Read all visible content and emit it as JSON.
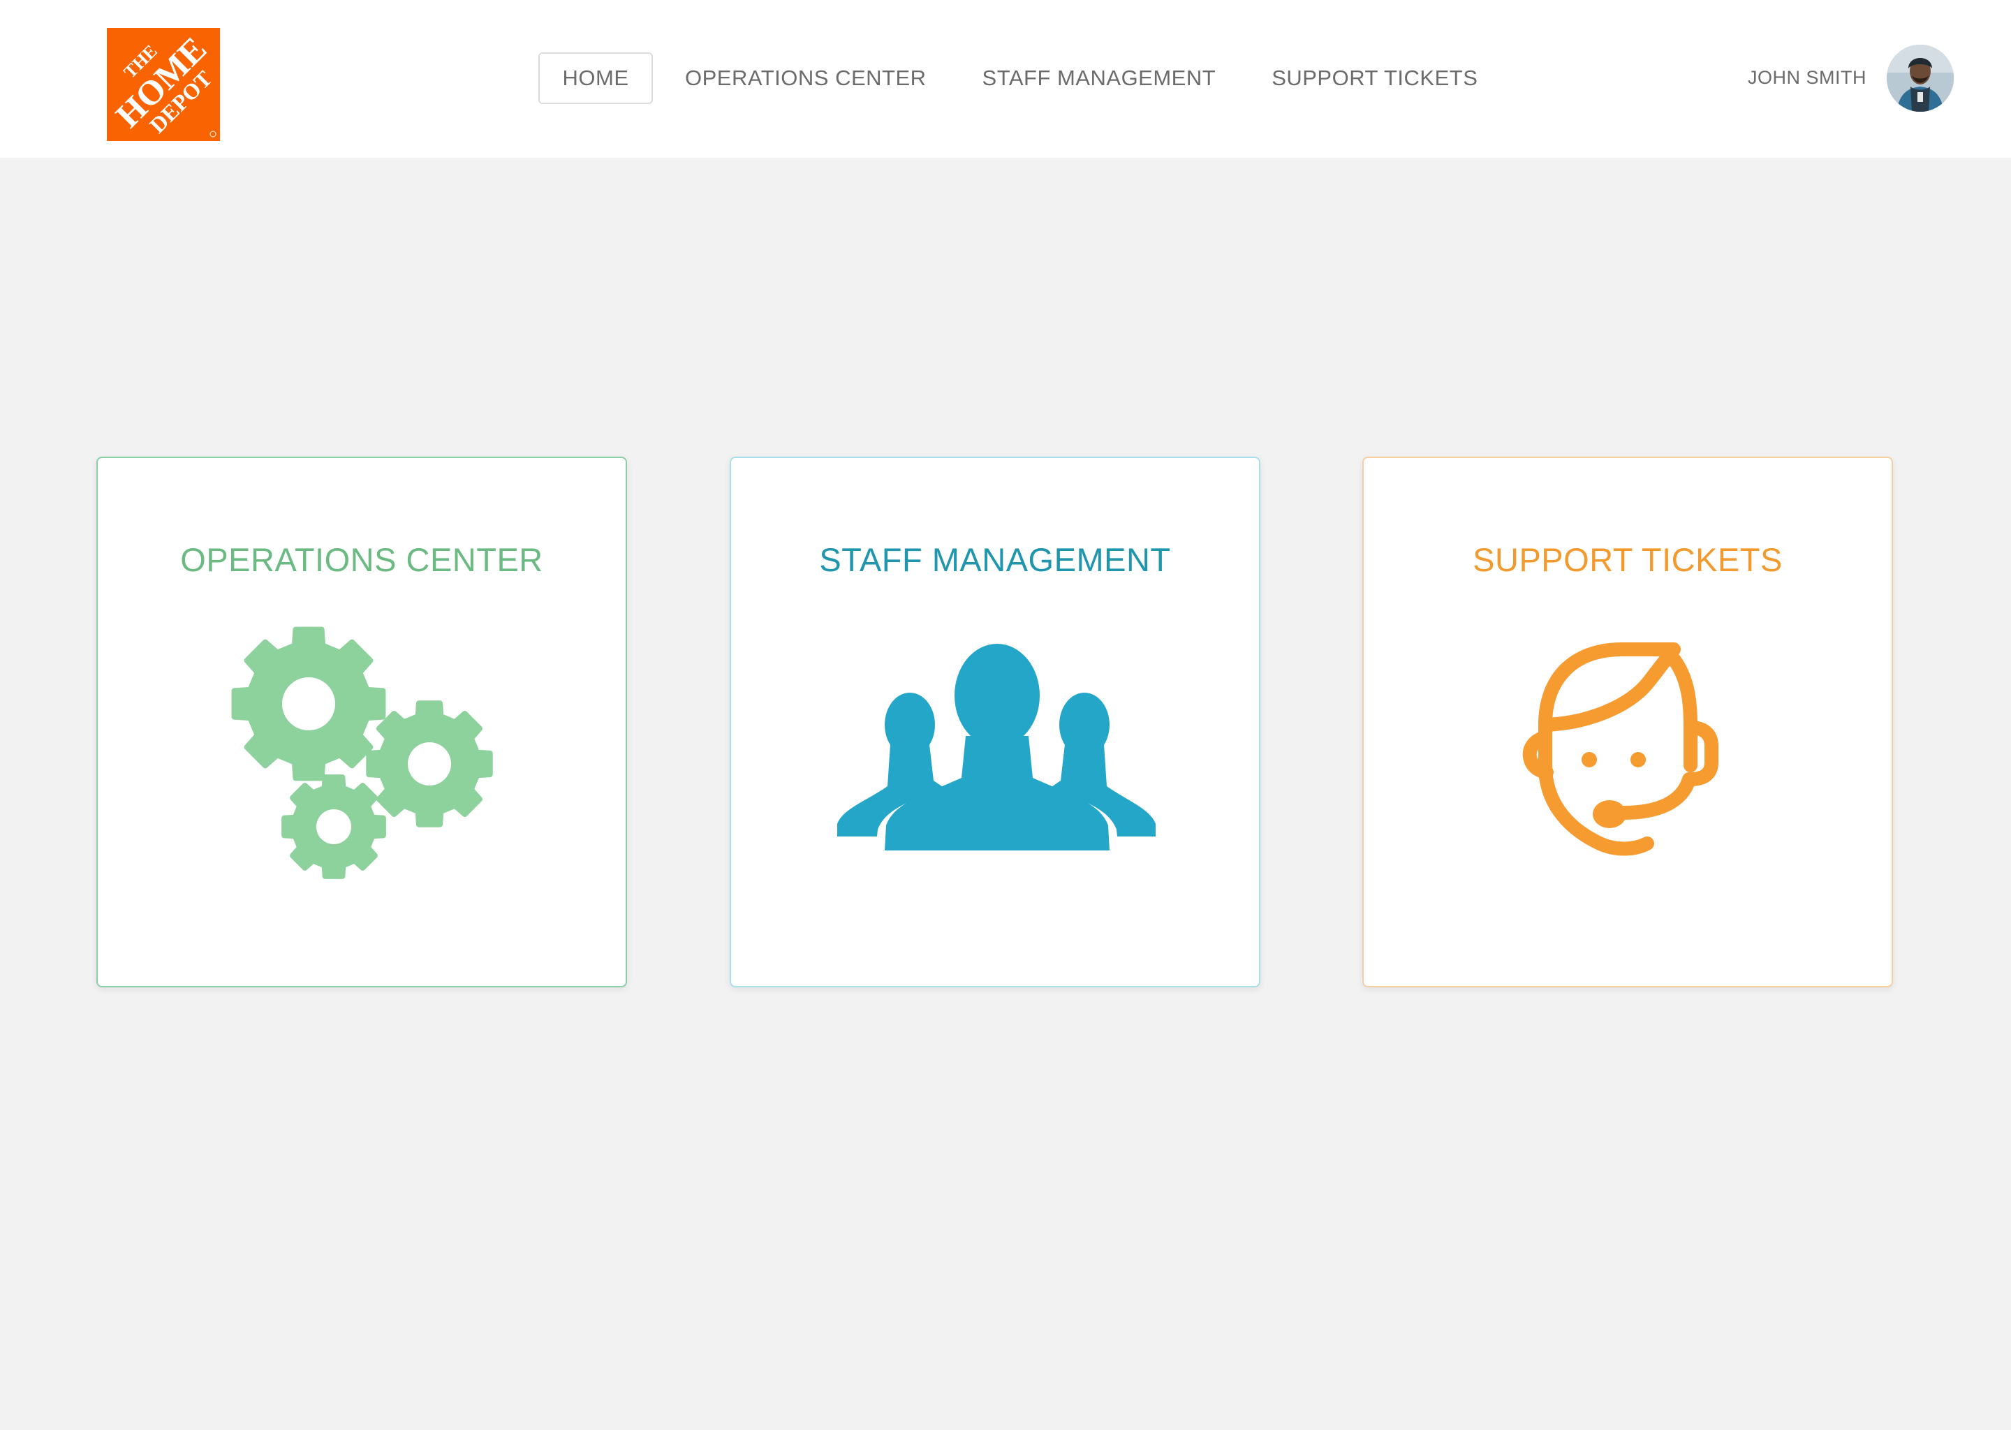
{
  "brand": {
    "logo_text": [
      "THE",
      "HOME",
      "DEPOT"
    ],
    "logo_color": "#f96302"
  },
  "nav": {
    "items": [
      {
        "label": "HOME",
        "active": true
      },
      {
        "label": "OPERATIONS CENTER",
        "active": false
      },
      {
        "label": "STAFF MANAGEMENT",
        "active": false
      },
      {
        "label": "SUPPORT TICKETS",
        "active": false
      }
    ]
  },
  "user": {
    "name": "JOHN SMITH",
    "avatar_icon": "user-avatar-photo"
  },
  "cards": [
    {
      "title": "OPERATIONS CENTER",
      "icon": "gears-icon",
      "color": "#6bba82",
      "icon_color": "#8dd19c"
    },
    {
      "title": "STAFF MANAGEMENT",
      "icon": "users-group-icon",
      "color": "#1f96ad",
      "icon_color": "#24a6c9"
    },
    {
      "title": "SUPPORT TICKETS",
      "icon": "headset-agent-icon",
      "color": "#f39a2e",
      "icon_color": "#f59b2f"
    }
  ]
}
